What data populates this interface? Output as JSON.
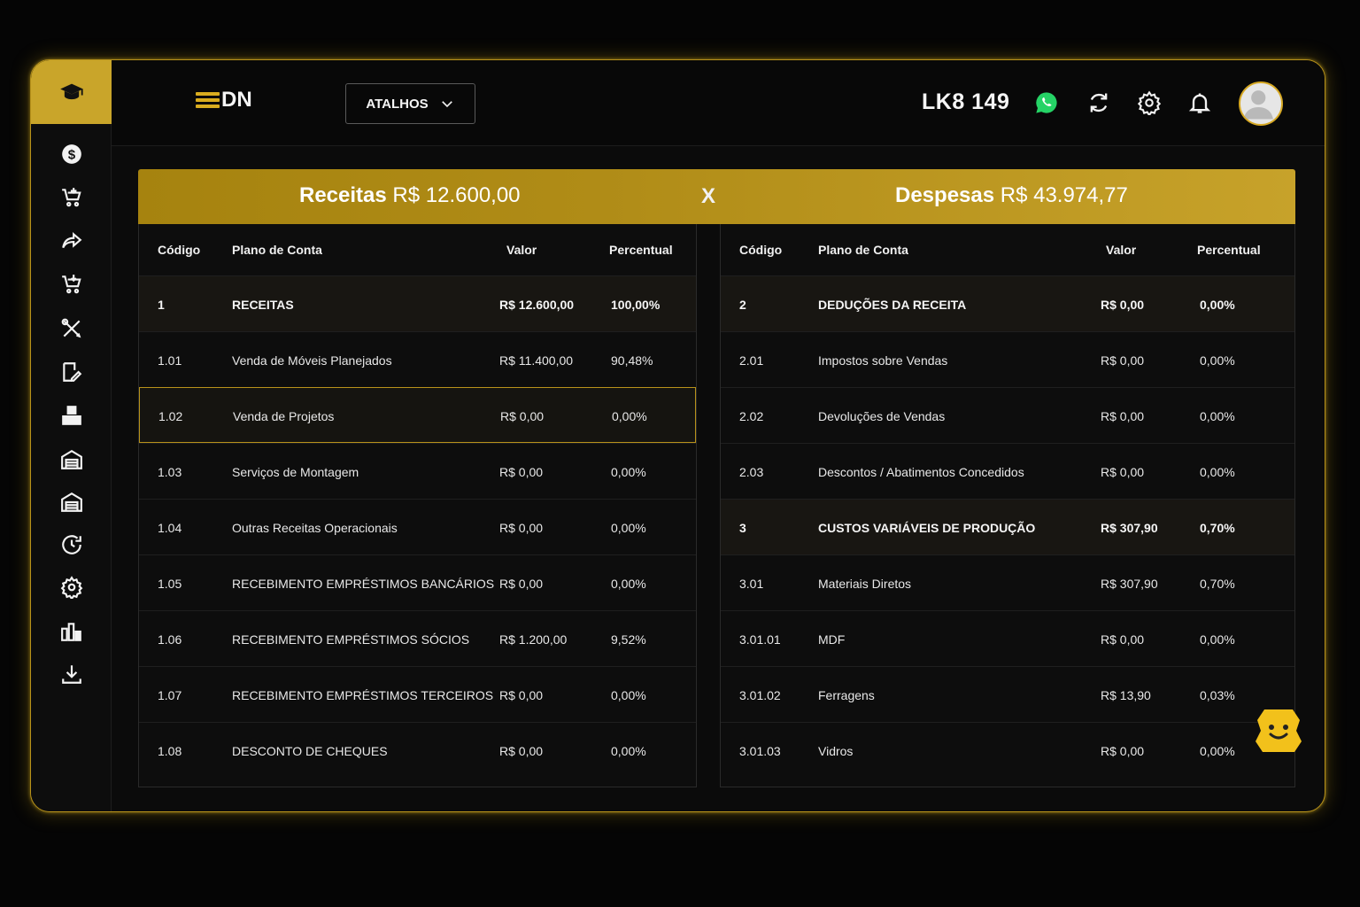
{
  "header": {
    "logo_text": "DN",
    "shortcut_label": "ATALHOS",
    "store_code": "LK8 149"
  },
  "sidebar": {
    "items": [
      {
        "icon": "graduation-cap-icon"
      },
      {
        "icon": "dollar-circle-icon"
      },
      {
        "icon": "cart-add-icon"
      },
      {
        "icon": "share-arrow-icon"
      },
      {
        "icon": "cart-download-icon"
      },
      {
        "icon": "tools-icon"
      },
      {
        "icon": "edit-document-icon"
      },
      {
        "icon": "boxes-icon"
      },
      {
        "icon": "warehouse-icon"
      },
      {
        "icon": "store-icon"
      },
      {
        "icon": "clock-history-icon"
      },
      {
        "icon": "gear-icon"
      },
      {
        "icon": "bar-chart-icon"
      },
      {
        "icon": "download-icon"
      }
    ]
  },
  "colors": {
    "accent": "#c9a52a",
    "background": "#050505",
    "whatsapp": "#25d366"
  },
  "summary": {
    "revenue_label": "Receitas",
    "revenue_value": "R$ 12.600,00",
    "versus": "X",
    "expense_label": "Despesas",
    "expense_value": "R$ 43.974,77"
  },
  "revenue_table": {
    "columns": [
      "Código",
      "Plano de Conta",
      "Valor",
      "Percentual"
    ],
    "rows": [
      {
        "code": "1",
        "account": "RECEITAS",
        "value": "R$ 12.600,00",
        "percent": "100,00%",
        "group": true
      },
      {
        "code": "1.01",
        "account": "Venda de Móveis Planejados",
        "value": "R$ 11.400,00",
        "percent": "90,48%"
      },
      {
        "code": "1.02",
        "account": "Venda de Projetos",
        "value": "R$ 0,00",
        "percent": "0,00%",
        "selected": true
      },
      {
        "code": "1.03",
        "account": "Serviços de Montagem",
        "value": "R$ 0,00",
        "percent": "0,00%"
      },
      {
        "code": "1.04",
        "account": "Outras Receitas Operacionais",
        "value": "R$ 0,00",
        "percent": "0,00%"
      },
      {
        "code": "1.05",
        "account": "RECEBIMENTO EMPRÉSTIMOS BANCÁRIOS",
        "value": "R$ 0,00",
        "percent": "0,00%"
      },
      {
        "code": "1.06",
        "account": "RECEBIMENTO EMPRÉSTIMOS SÓCIOS",
        "value": "R$ 1.200,00",
        "percent": "9,52%"
      },
      {
        "code": "1.07",
        "account": "RECEBIMENTO EMPRÉSTIMOS TERCEIROS",
        "value": "R$ 0,00",
        "percent": "0,00%"
      },
      {
        "code": "1.08",
        "account": "DESCONTO DE CHEQUES",
        "value": "R$ 0,00",
        "percent": "0,00%"
      }
    ]
  },
  "expense_table": {
    "columns": [
      "Código",
      "Plano de Conta",
      "Valor",
      "Percentual"
    ],
    "rows": [
      {
        "code": "2",
        "account": "DEDUÇÕES DA RECEITA",
        "value": "R$ 0,00",
        "percent": "0,00%",
        "group": true
      },
      {
        "code": "2.01",
        "account": "Impostos sobre Vendas",
        "value": "R$ 0,00",
        "percent": "0,00%"
      },
      {
        "code": "2.02",
        "account": "Devoluções de Vendas",
        "value": "R$ 0,00",
        "percent": "0,00%"
      },
      {
        "code": "2.03",
        "account": "Descontos / Abatimentos Concedidos",
        "value": "R$ 0,00",
        "percent": "0,00%"
      },
      {
        "code": "3",
        "account": "CUSTOS VARIÁVEIS DE PRODUÇÃO",
        "value": "R$ 307,90",
        "percent": "0,70%",
        "group": true
      },
      {
        "code": "3.01",
        "account": "Materiais Diretos",
        "value": "R$ 307,90",
        "percent": "0,70%"
      },
      {
        "code": "3.01.01",
        "account": "MDF",
        "value": "R$ 0,00",
        "percent": "0,00%"
      },
      {
        "code": "3.01.02",
        "account": "Ferragens",
        "value": "R$ 13,90",
        "percent": "0,03%"
      },
      {
        "code": "3.01.03",
        "account": "Vidros",
        "value": "R$ 0,00",
        "percent": "0,00%"
      }
    ]
  }
}
